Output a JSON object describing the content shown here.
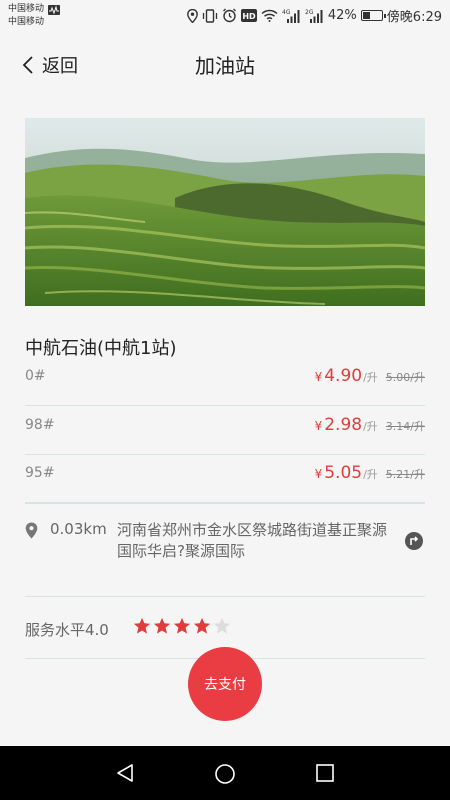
{
  "status_bar": {
    "carrier1": "中国移动",
    "carrier2": "中国移动",
    "battery_percent": "42%",
    "battery_level": 0.42,
    "time": "傍晚6:29",
    "icons": [
      "location-icon",
      "vibrate-icon",
      "alarm-icon",
      "hd-icon",
      "wifi-icon",
      "signal-4g-icon",
      "signal-2g-icon",
      "battery-icon"
    ]
  },
  "header": {
    "back_label": "返回",
    "title": "加油站"
  },
  "station": {
    "name": "中航石油(中航1站)"
  },
  "fuels": [
    {
      "grade": "0#",
      "currency": "¥",
      "price": "4.90",
      "unit": "/升",
      "old_price": "5.00/升"
    },
    {
      "grade": "98#",
      "currency": "¥",
      "price": "2.98",
      "unit": "/升",
      "old_price": "3.14/升"
    },
    {
      "grade": "95#",
      "currency": "¥",
      "price": "5.05",
      "unit": "/升",
      "old_price": "5.21/升"
    }
  ],
  "location": {
    "distance": "0.03km",
    "address": "河南省郑州市金水区祭城路街道基正聚源国际华启?聚源国际"
  },
  "service": {
    "label": "服务水平4.0",
    "rating": 4,
    "max_rating": 5
  },
  "pay_button": "去支付",
  "colors": {
    "accent_red": "#ea3d43",
    "price_red": "#e03c3c",
    "star_red": "#e03c3c",
    "star_empty": "#dddddd"
  }
}
